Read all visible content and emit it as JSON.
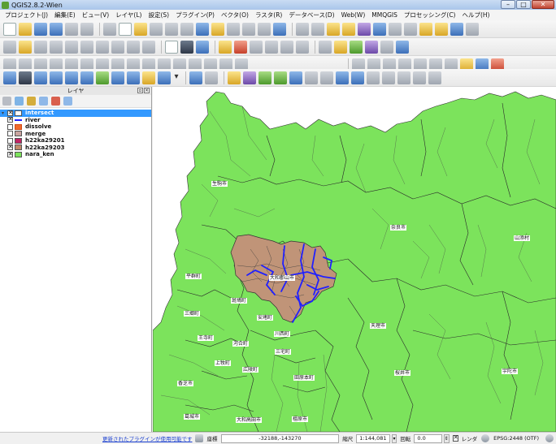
{
  "window": {
    "title": "QGIS2.8.2-Wien",
    "minimize": "–",
    "maximize": "□",
    "close": "✕"
  },
  "menu": [
    "プロジェクト(J)",
    "編集(E)",
    "ビュー(V)",
    "レイヤ(L)",
    "設定(S)",
    "プラグイン(P)",
    "ベクタ(O)",
    "ラスタ(R)",
    "データベース(D)",
    "Web(W)",
    "MMQGIS",
    "プロセッシング(C)",
    "ヘルプ(H)"
  ],
  "layers_panel": {
    "title": "レイヤ",
    "layers": [
      {
        "name": "intersect",
        "checked": true,
        "expanded": true,
        "color": "#ffffff",
        "selected": true
      },
      {
        "name": "river",
        "checked": true,
        "expanded": false,
        "color": "#2020ff",
        "selected": false
      },
      {
        "name": "dissolve",
        "checked": false,
        "expanded": false,
        "color": "#f06a2c",
        "selected": false
      },
      {
        "name": "merge",
        "checked": false,
        "expanded": false,
        "color": "#c9a4a0",
        "selected": false
      },
      {
        "name": "h22ka29201",
        "checked": false,
        "expanded": false,
        "color": "#c02464",
        "selected": false
      },
      {
        "name": "h22ka29203",
        "checked": true,
        "expanded": false,
        "color": "#c08a6a",
        "selected": false
      },
      {
        "name": "nara_ken",
        "checked": true,
        "expanded": false,
        "color": "#7ce35c",
        "selected": false
      }
    ]
  },
  "map": {
    "land_color": "#7ce35c",
    "highlight_color": "#c09478",
    "river_color": "#2020ff",
    "labels": [
      "生駒市",
      "奈良市",
      "山添村",
      "平群町",
      "大和郡山市",
      "斑鳩町",
      "安堵町",
      "三郷町",
      "天理市",
      "川西町",
      "王寺町",
      "河合町",
      "三宅町",
      "上牧町",
      "広陵町",
      "田原本町",
      "香芝市",
      "桜井市",
      "宇陀市",
      "葛城市",
      "大和高田市",
      "橿原市"
    ]
  },
  "status": {
    "plugin_update": "更新されたプラグインが使用可能です",
    "coord_label": "座標",
    "coordinates": "-32188,-143270",
    "scale_label": "縮尺",
    "scale": "1:144,081",
    "rotation_label": "回転",
    "rotation": "0.0",
    "render_label": "レンダ",
    "crs": "EPSG:2448 (OTF)"
  }
}
